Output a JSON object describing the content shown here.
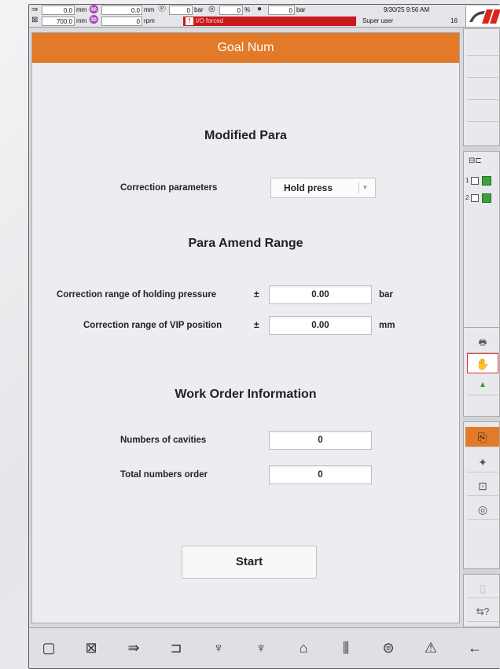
{
  "status": {
    "pos1_value": "0.0",
    "pos1_unit": "mm",
    "pos2_value": "0.0",
    "pos2_unit": "mm",
    "pos3_value": "700.0",
    "pos3_unit": "mm",
    "speed_value": "0",
    "speed_unit": "rpm",
    "pressure1_value": "0",
    "pressure1_unit": "bar",
    "percent_value": "0",
    "percent_unit": "%",
    "pressure2_value": "0",
    "pressure2_unit": "bar",
    "alarm_text": "I/O forced",
    "datetime": "9/30/25 9:56 AM",
    "user": "Super user",
    "user_level": "16"
  },
  "panel": {
    "title": "Goal Num",
    "modified_para_title": "Modified Para",
    "correction_params_label": "Correction parameters",
    "correction_params_value": "Hold press",
    "amend_range_title": "Para Amend Range",
    "hold_pressure_label": "Correction range of holding pressure",
    "hold_pressure_pm": "±",
    "hold_pressure_value": "0.00",
    "hold_pressure_unit": "bar",
    "vip_label": "Correction range of VIP position",
    "vip_pm": "±",
    "vip_value": "0.00",
    "vip_unit": "mm",
    "work_order_title": "Work Order Information",
    "cavities_label": "Numbers of cavities",
    "cavities_value": "0",
    "total_order_label": "Total numbers order",
    "total_order_value": "0",
    "start_label": "Start"
  },
  "sidebar": {
    "row1": "1",
    "row2": "2"
  },
  "colors": {
    "accent": "#e27a2a",
    "alarm": "#c8191b",
    "status_green": "#40a13a"
  }
}
